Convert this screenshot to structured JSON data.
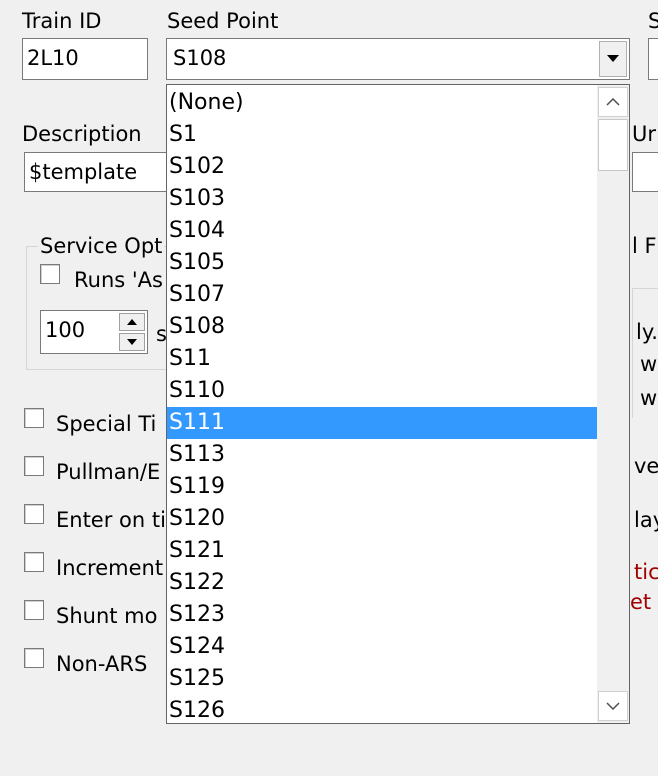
{
  "labels": {
    "train_id": "Train ID",
    "seed_point": "Seed Point",
    "description": "Description",
    "service_options": "Service Opt",
    "right_top_cut": "S",
    "right_un_cut": "Ur",
    "right_f_cut": "l F"
  },
  "fields": {
    "train_id": "2L10",
    "seed_point": "S108",
    "description": "$template",
    "spinner": "100"
  },
  "service_options": {
    "runs_as_label": "Runs 'As",
    "spinner_suffix": "s"
  },
  "checkboxes": [
    {
      "label": "Special Ti"
    },
    {
      "label": "Pullman/E"
    },
    {
      "label": "Enter on ti"
    },
    {
      "label": "Increment"
    },
    {
      "label": "Shunt mo"
    },
    {
      "label": "Non-ARS"
    }
  ],
  "right_fragments": {
    "ly": "ly.",
    "w1": "w",
    "w2": "w",
    "ver": "ver",
    "lay": "lay",
    "tic": "tic",
    "et": "et e"
  },
  "dropdown": {
    "items": [
      "(None)",
      "S1",
      "S102",
      "S103",
      "S104",
      "S105",
      "S107",
      "S108",
      "S11",
      "S110",
      "S111",
      "S113",
      "S119",
      "S120",
      "S121",
      "S122",
      "S123",
      "S124",
      "S125",
      "S126"
    ],
    "selected": "S111"
  },
  "colors": {
    "selection": "#3399ff",
    "warning_text": "#a00000"
  }
}
